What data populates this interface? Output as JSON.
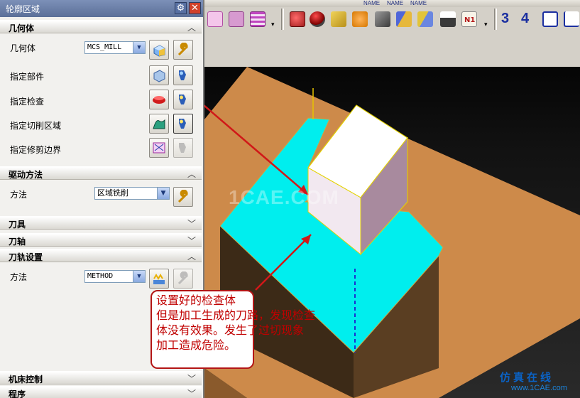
{
  "dialog": {
    "title": "轮廓区域",
    "sections": {
      "geometry": {
        "label": "几何体",
        "rows": {
          "geometry": {
            "label": "几何体",
            "value": "MCS_MILL"
          },
          "part": {
            "label": "指定部件"
          },
          "check": {
            "label": "指定检查"
          },
          "cut_area": {
            "label": "指定切削区域"
          },
          "trim": {
            "label": "指定修剪边界"
          }
        }
      },
      "drive": {
        "label": "驱动方法",
        "method_label": "方法",
        "method_value": "区域铣削"
      },
      "tool": {
        "label": "刀具"
      },
      "axis": {
        "label": "刀轴"
      },
      "path_settings": {
        "label": "刀轨设置",
        "method_label": "方法",
        "method_value": "METHOD"
      },
      "machine": {
        "label": "机床控制"
      },
      "program": {
        "label": "程序"
      }
    }
  },
  "toolbar": {
    "name_labels": [
      "NAME",
      "NAME",
      "NAME"
    ],
    "numbers": [
      "3",
      "4"
    ]
  },
  "annotation": {
    "lines": [
      "设置好的检查体",
      "但是加工生成的刀路，发现检查",
      "体没有效果。发生了过切现象",
      "加工造成危险。"
    ]
  },
  "watermark": "1CAE.COM",
  "footer_logo": {
    "cn": "仿真在线",
    "url": "www.1CAE.com"
  },
  "colors": {
    "accent": "#d01818",
    "cyan": "#00f0f0",
    "wood": "#cd8a4a"
  }
}
